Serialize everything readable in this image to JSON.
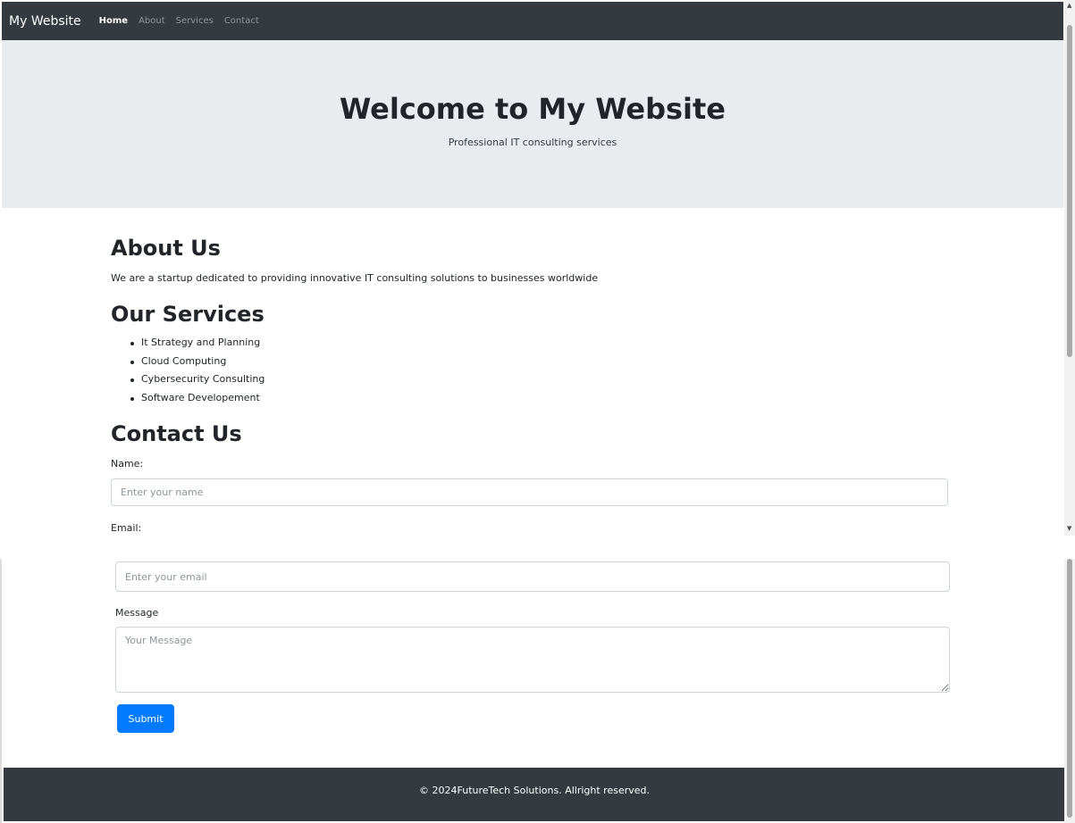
{
  "navbar": {
    "brand": "My Website",
    "links": [
      {
        "label": "Home",
        "active": true
      },
      {
        "label": "About",
        "active": false
      },
      {
        "label": "Services",
        "active": false
      },
      {
        "label": "Contact",
        "active": false
      }
    ],
    "bg_color": "#343a40"
  },
  "hero": {
    "title": "Welcome to My Website",
    "subtitle": "Professional IT consulting services",
    "bg_color": "#e9ecef"
  },
  "about": {
    "heading": "About Us",
    "text": "We are a startup dedicated to providing innovative IT consulting solutions to businesses worldwide"
  },
  "services": {
    "heading": "Our Services",
    "items": [
      "It Strategy and Planning",
      "Cloud Computing",
      "Cybersecurity Consulting",
      "Software Developement"
    ]
  },
  "contact": {
    "heading": "Contact Us",
    "name_label": "Name:",
    "name_placeholder": "Enter your name",
    "email_label": "Email:",
    "email_placeholder": "Enter your email",
    "message_label": "Message",
    "message_placeholder": "Your Message",
    "submit_label": "Submit",
    "submit_color": "#007bff"
  },
  "footer": {
    "text": "© 2024FutureTech Solutions. Allright reserved."
  }
}
